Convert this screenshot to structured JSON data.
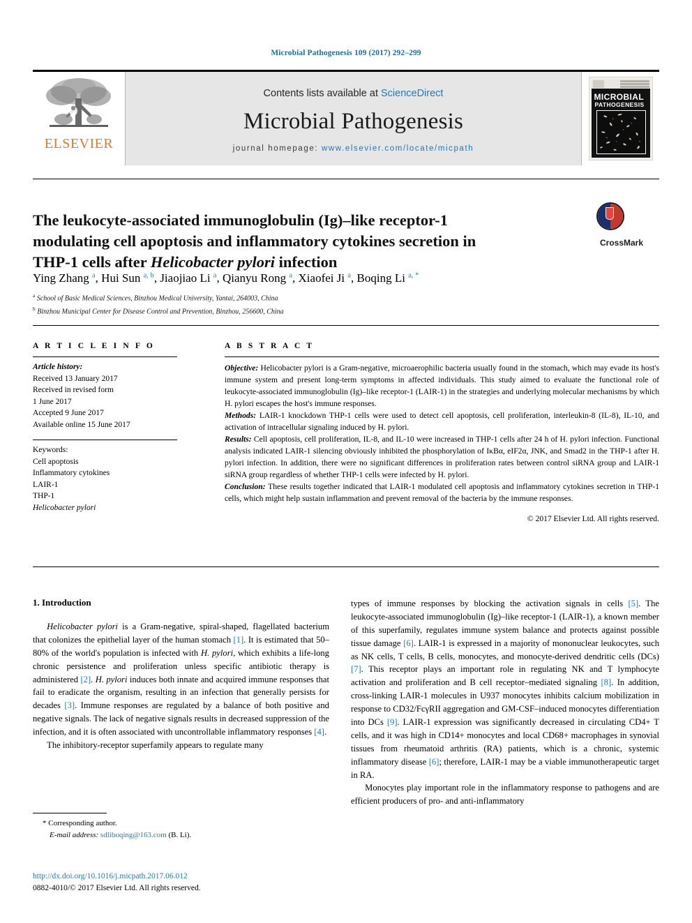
{
  "running_head": "Microbial Pathogenesis 109 (2017) 292–299",
  "masthead": {
    "publisher_name": "ELSEVIER",
    "contents_prefix": "Contents lists available at ",
    "contents_link": "ScienceDirect",
    "journal_name": "Microbial Pathogenesis",
    "homepage_prefix": "journal homepage: ",
    "homepage_url": "www.elsevier.com/locate/micpath",
    "cover_title_line1": "MICROBIAL",
    "cover_title_line2": "PATHOGENESIS"
  },
  "badge": {
    "crossmark_label": "CrossMark"
  },
  "article": {
    "title_line1": "The leukocyte-associated immunoglobulin (Ig)–like receptor-1",
    "title_line2": "modulating cell apoptosis and inflammatory cytokines secretion in",
    "title_line3_pre": "THP-1 cells after ",
    "title_line3_ital": "Helicobacter pylori",
    "title_line3_post": " infection",
    "authors": "Ying Zhang a, Hui Sun a, b, Jiaojiao Li a, Qianyu Rong a, Xiaofei Ji a, Boqing Li a, *",
    "affiliation_a": "School of Basic Medical Sciences, Binzhou Medical University, Yantai, 264003, China",
    "affiliation_b": "Binzhou Municipal Center for Disease Control and Prevention, Binzhou, 256600, China"
  },
  "article_info": {
    "heading": "A R T I C L E  I N F O",
    "history_label": "Article history:",
    "history": [
      "Received 13 January 2017",
      "Received in revised form",
      "1 June 2017",
      "Accepted 9 June 2017",
      "Available online 15 June 2017"
    ],
    "keywords_label": "Keywords:",
    "keywords": [
      "Cell apoptosis",
      "Inflammatory cytokines",
      "LAIR-1",
      "THP-1"
    ],
    "keyword_italic": "Helicobacter pylori"
  },
  "abstract": {
    "heading": "A B S T R A C T",
    "objective_label": "Objective:",
    "objective_text": " Helicobacter pylori is a Gram-negative, microaerophilic bacteria usually found in the stomach, which may evade its host's immune system and present long-term symptoms in affected individuals. This study aimed to evaluate the functional role of leukocyte-associated immunoglobulin (Ig)–like receptor-1 (LAIR-1) in the strategies and underlying molecular mechanisms by which H. pylori escapes the host's immune responses.",
    "methods_label": "Methods:",
    "methods_text": " LAIR-1 knockdown THP-1 cells were used to detect cell apoptosis, cell proliferation, interleukin-8 (IL-8), IL-10, and activation of intracellular signaling induced by H. pylori.",
    "results_label": "Results:",
    "results_text": " Cell apoptosis, cell proliferation, IL-8, and IL-10 were increased in THP-1 cells after 24 h of H. pylori infection. Functional analysis indicated LAIR-1 silencing obviously inhibited the phosphorylation of IκBα, eIF2α, JNK, and Smad2 in the THP-1 after H. pylori infection. In addition, there were no significant differences in proliferation rates between control siRNA group and LAIR-1 siRNA group regardless of whether THP-1 cells were infected by H. pylori.",
    "conclusion_label": "Conclusion:",
    "conclusion_text": " These results together indicated that LAIR-1 modulated cell apoptosis and inflammatory cytokines secretion in THP-1 cells, which might help sustain inflammation and prevent removal of the bacteria by the immune responses.",
    "copyright": "© 2017 Elsevier Ltd. All rights reserved."
  },
  "introduction": {
    "heading": "1. Introduction",
    "para1": "Helicobacter pylori is a Gram-negative, spiral-shaped, flagellated bacterium that colonizes the epithelial layer of the human stomach [1]. It is estimated that 50–80% of the world's population is infected with H. pylori, which exhibits a life-long chronic persistence and proliferation unless specific antibiotic therapy is administered [2]. H. pylori induces both innate and acquired immune responses that fail to eradicate the organism, resulting in an infection that generally persists for decades [3]. Immune responses are regulated by a balance of both positive and negative signals. The lack of negative signals results in decreased suppression of the infection, and it is often associated with uncontrollable inflammatory responses [4].",
    "para2": "The inhibitory-receptor superfamily appears to regulate many types of immune responses by blocking the activation signals in cells [5]. The leukocyte-associated immunoglobulin (Ig)–like receptor-1 (LAIR-1), a known member of this superfamily, regulates immune system balance and protects against possible tissue damage [6]. LAIR-1 is expressed in a majority of mononuclear leukocytes, such as NK cells, T cells, B cells, monocytes, and monocyte-derived dendritic cells (DCs) [7]. This receptor plays an important role in regulating NK and T lymphocyte activation and proliferation and B cell receptor–mediated signaling [8]. In addition, cross-linking LAIR-1 molecules in U937 monocytes inhibits calcium mobilization in response to CD32/FcγRII aggregation and GM-CSF–induced monocytes differentiation into DCs [9]. LAIR-1 expression was significantly decreased in circulating CD4+ T cells, and it was high in CD14+ monocytes and local CD68+ macrophages in synovial tissues from rheumatoid arthritis (RA) patients, which is a chronic, systemic inflammatory disease [6]; therefore, LAIR-1 may be a viable immunotherapeutic target in RA.",
    "para3": "Monocytes play important role in the inflammatory response to pathogens and are efficient producers of pro- and anti-inflammatory"
  },
  "footer": {
    "corresponding_label": "* Corresponding author.",
    "email_label": "E-mail address:",
    "email": "sdliboqing@163.com",
    "email_suffix": " (B. Li).",
    "doi_url": "http://dx.doi.org/10.1016/j.micpath.2017.06.012",
    "issn_line": "0882-4010/© 2017 Elsevier Ltd. All rights reserved."
  },
  "colors": {
    "link": "#1a7bbd",
    "elsevier_orange": "#e87722",
    "band_gray": "#e6e6e6"
  }
}
